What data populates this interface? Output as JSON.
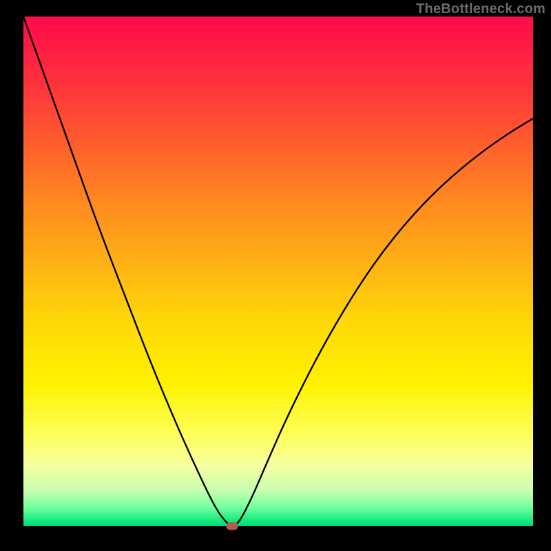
{
  "attribution": "TheBottleneck.com",
  "chart_data": {
    "type": "line",
    "title": "",
    "xlabel": "",
    "ylabel": "",
    "xlim": [
      0,
      100
    ],
    "ylim": [
      0,
      100
    ],
    "series": [
      {
        "name": "bottleneck-curve",
        "x": [
          0,
          5,
          10,
          15,
          20,
          25,
          30,
          35,
          38,
          40,
          41,
          42,
          43,
          45,
          48,
          52,
          58,
          65,
          72,
          80,
          88,
          95,
          100
        ],
        "y": [
          100,
          86,
          72,
          58,
          45,
          32,
          20,
          9,
          3,
          0.5,
          0,
          0.5,
          2,
          6,
          13,
          22,
          34,
          46,
          56,
          65,
          72,
          77,
          80
        ]
      }
    ],
    "marker": {
      "x": 41,
      "y": 0,
      "color": "#b85a54"
    },
    "background_gradient": {
      "top": "#ff0a4a",
      "bottom": "#00d873"
    },
    "grid": false,
    "legend": false
  }
}
